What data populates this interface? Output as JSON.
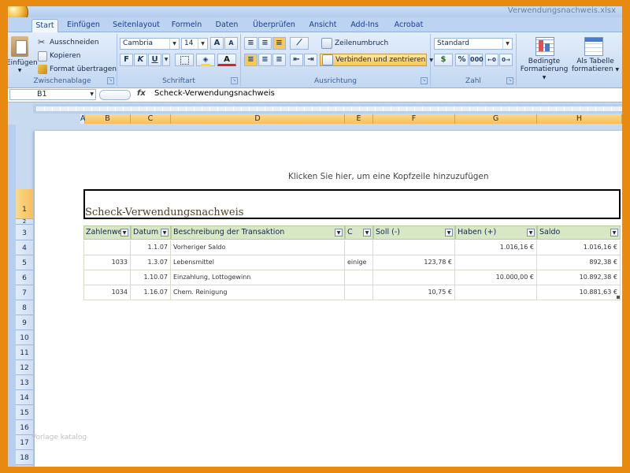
{
  "window": {
    "title": "Verwendungsnachweis.xlsx"
  },
  "tabs": [
    "Start",
    "Einfügen",
    "Seitenlayout",
    "Formeln",
    "Daten",
    "Überprüfen",
    "Ansicht",
    "Add-Ins",
    "Acrobat"
  ],
  "ribbon": {
    "clipboard": {
      "paste": "Einfügen",
      "cut": "Ausschneiden",
      "copy": "Kopieren",
      "format_painter": "Format übertragen",
      "label": "Zwischenablage"
    },
    "font": {
      "name": "Cambria",
      "size": "14",
      "bold": "F",
      "italic": "K",
      "underline": "U",
      "grow": "A",
      "shrink": "A",
      "font_color": "A",
      "label": "Schriftart"
    },
    "alignment": {
      "wrap": "Zeilenumbruch",
      "merge": "Verbinden und zentrieren",
      "label": "Ausrichtung"
    },
    "number": {
      "format": "Standard",
      "currency": "$",
      "percent": "%",
      "thousands": "000",
      "label": "Zahl"
    },
    "styles": {
      "conditional": [
        "Bedingte",
        "Formatierung"
      ],
      "as_table": [
        "Als Tabelle",
        "formatieren"
      ]
    }
  },
  "formula_bar": {
    "name_box": "B1",
    "fx": "fx",
    "content": "Scheck-Verwendungsnachweis"
  },
  "columns": [
    "A",
    "B",
    "C",
    "D",
    "E",
    "F",
    "G",
    "H"
  ],
  "rows": [
    "1",
    "2",
    "3",
    "4",
    "5",
    "6",
    "7",
    "8",
    "9",
    "10",
    "11",
    "12",
    "13",
    "14",
    "15",
    "16",
    "17",
    "18"
  ],
  "sheet": {
    "header_hint": "Klicken Sie hier, um eine Kopfzeile hinzuzufügen",
    "title": "Scheck-Verwendungsnachweis",
    "table_headers": [
      "Zahlenwert",
      "Datum",
      "Beschreibung der Transaktion",
      "C",
      "Soll (-)",
      "Haben (+)",
      "Saldo"
    ],
    "table_rows": [
      [
        "",
        "1.1.07",
        "Vorheriger Saldo",
        "",
        "",
        "1.016,16 €",
        "1.016,16 €"
      ],
      [
        "1033",
        "1.3.07",
        "Lebensmittel",
        "einige",
        "123,78 €",
        "",
        "892,38 €"
      ],
      [
        "",
        "1.10.07",
        "Einzahlung, Lottogewinn",
        "",
        "",
        "10.000,00 €",
        "10.892,38 €"
      ],
      [
        "1034",
        "1.16.07",
        "Chem. Reinigung",
        "",
        "10,75 €",
        "",
        "10.881,63 €"
      ]
    ]
  },
  "watermark": "Vorlage katalog",
  "colors": {
    "frame": "#e88a10",
    "table_header": "#d8e8c4",
    "selected_header": "#f6bf5c"
  }
}
